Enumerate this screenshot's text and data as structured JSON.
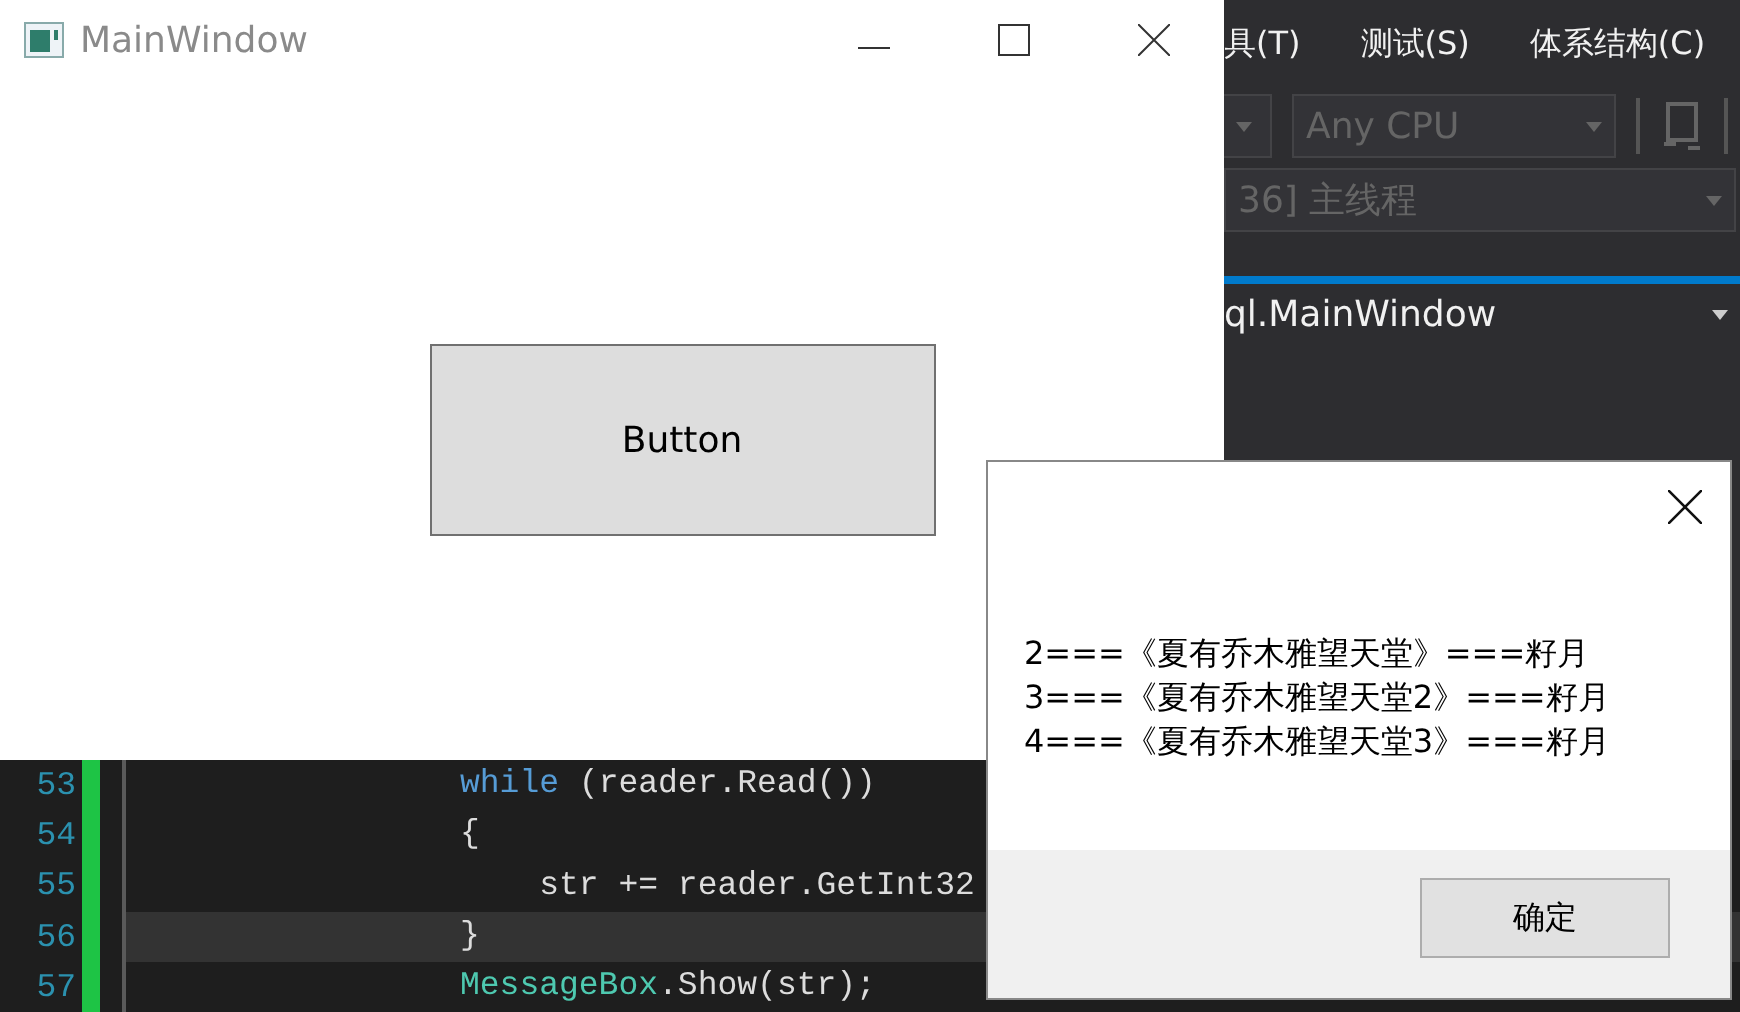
{
  "ide": {
    "menu": [
      {
        "label": "具(T)"
      },
      {
        "label": "测试(S)"
      },
      {
        "label": "体系结构(C)"
      }
    ],
    "toolbar": {
      "platform": "Any CPU"
    },
    "thread_selector": "36] 主线程",
    "type_selector": "ql.MainWindow",
    "code_lines": [
      {
        "number": "53",
        "current": false,
        "tokens": [
          {
            "kind": "keyword",
            "text": "while"
          },
          {
            "kind": "plain",
            "text": " (reader.Read())"
          }
        ]
      },
      {
        "number": "54",
        "current": false,
        "tokens": [
          {
            "kind": "plain",
            "text": "{"
          }
        ]
      },
      {
        "number": "55",
        "current": false,
        "tokens": [
          {
            "kind": "plain",
            "text": "    str += reader.GetInt32"
          }
        ]
      },
      {
        "number": "56",
        "current": true,
        "tokens": [
          {
            "kind": "plain",
            "text": "}"
          }
        ]
      },
      {
        "number": "57",
        "current": false,
        "tokens": [
          {
            "kind": "type",
            "text": "MessageBox"
          },
          {
            "kind": "plain",
            "text": ".Show(str);"
          }
        ]
      }
    ]
  },
  "main_window": {
    "title": "MainWindow",
    "button": "Button"
  },
  "message_box": {
    "lines": [
      "2===《夏有乔木雅望天堂》===籽月",
      "3===《夏有乔木雅望天堂2》===籽月",
      "4===《夏有乔木雅望天堂3》===籽月"
    ],
    "button": "确定"
  }
}
